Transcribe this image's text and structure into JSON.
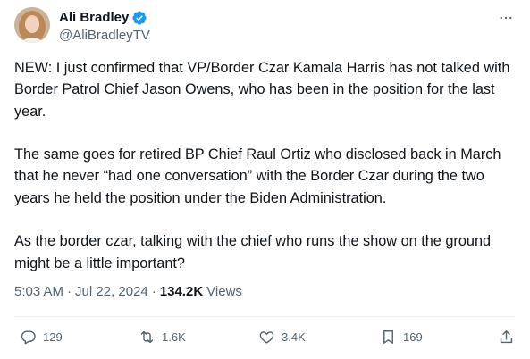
{
  "author": {
    "display_name": "Ali Bradley",
    "handle": "@AliBradleyTV",
    "verified": true
  },
  "tweet": {
    "paragraphs": [
      "NEW: I just confirmed that VP/Border Czar Kamala Harris has not talked with Border Patrol Chief Jason Owens, who has been in the position for the last year.",
      "The same goes for retired BP Chief Raul Ortiz who disclosed back in March that he never “had one conversation” with the Border Czar during the two years he held the position under the Biden Administration.",
      "As the border czar, talking with the chief who runs the show on the ground might be a little important?"
    ],
    "time": "5:03 AM",
    "date": "Jul 22, 2024",
    "views_count": "134.2K",
    "views_label": "Views"
  },
  "actions": {
    "replies": "129",
    "retweets": "1.6K",
    "likes": "3.4K",
    "bookmarks": "169"
  },
  "colors": {
    "text": "#0f1419",
    "secondary": "#536471",
    "verified": "#1d9bf0",
    "divider": "#eff3f4"
  },
  "icons": [
    "more-icon",
    "verified-badge-icon",
    "reply-icon",
    "retweet-icon",
    "like-icon",
    "bookmark-icon",
    "share-icon"
  ]
}
